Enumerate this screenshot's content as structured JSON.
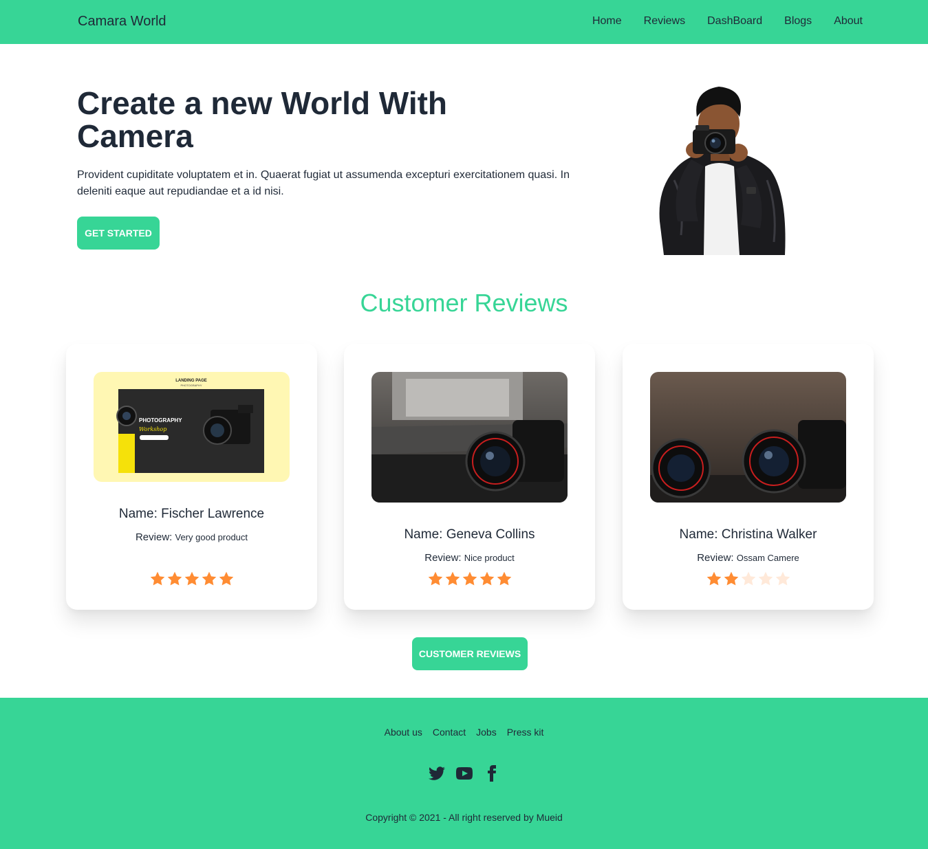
{
  "navbar": {
    "brand": "Camara World",
    "links": [
      "Home",
      "Reviews",
      "DashBoard",
      "Blogs",
      "About"
    ]
  },
  "hero": {
    "title": "Create a new World With Camera",
    "text": "Provident cupiditate voluptatem et in. Quaerat fugiat ut assumenda excepturi exercitationem quasi. In deleniti eaque aut repudiandae et a id nisi.",
    "button": "GET STARTED"
  },
  "reviews": {
    "heading": "Customer Reviews",
    "name_prefix": "Name:",
    "review_prefix": "Review:",
    "cards": [
      {
        "name": "Fischer Lawrence",
        "review": "Very good product",
        "rating": 5,
        "image_banner_title": "LANDING PAGE",
        "image_banner_subtitle": "PHOTOGRAPHY",
        "image_heading": "PHOTOGRAPHY",
        "image_script": "Workshop"
      },
      {
        "name": "Geneva Collins",
        "review": "Nice product",
        "rating": 5
      },
      {
        "name": "Christina Walker",
        "review": "Ossam Camere",
        "rating": 2
      }
    ],
    "button": "CUSTOMER REVIEWS"
  },
  "footer": {
    "links": [
      "About us",
      "Contact",
      "Jobs",
      "Press kit"
    ],
    "social_icons": [
      "twitter-icon",
      "youtube-icon",
      "facebook-icon"
    ],
    "copyright": "Copyright © 2021 - All right reserved by Mueid"
  },
  "colors": {
    "accent": "#37d596",
    "text": "#1f2937",
    "star": "#ff8c33",
    "star_off": "#ffe2cc"
  }
}
